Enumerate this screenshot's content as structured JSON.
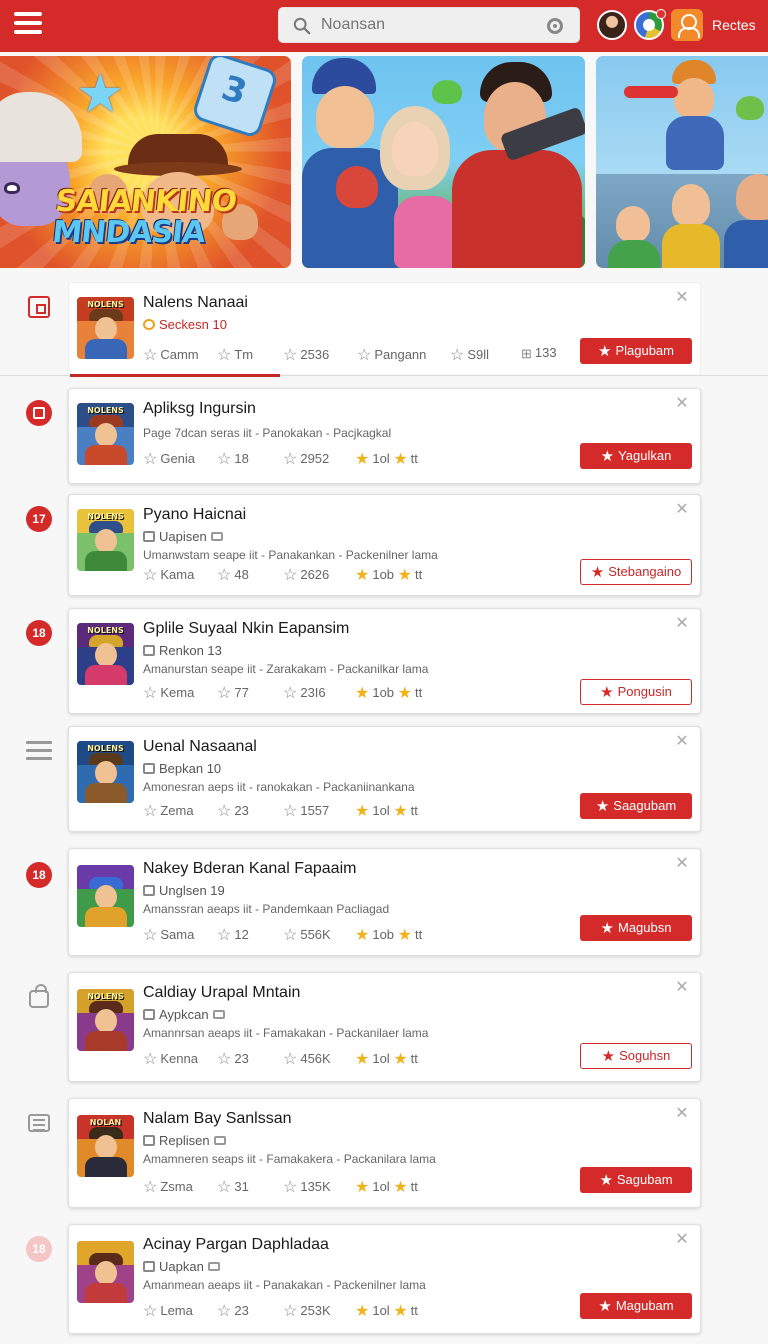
{
  "header": {
    "search_placeholder": "Noansan",
    "label": "Rectes",
    "icons": [
      "hamburger-icon",
      "search-icon",
      "mic-icon",
      "avatar",
      "chrome-icon",
      "profile-icon"
    ],
    "accent": "#d42a2a"
  },
  "banners": [
    {
      "title_line1": "SAIANKINO",
      "title_line2": "MNDASIA"
    },
    {
      "title_line1": "",
      "title_line2": ""
    },
    {
      "title_line1": "",
      "title_line2": ""
    }
  ],
  "items": [
    {
      "title": "Nalens Nanaai",
      "sub": "Seckesn 10",
      "desc": "",
      "stats": [
        "Camm",
        "Tm",
        "2536",
        "Pangann",
        "S9ll",
        "133"
      ],
      "action": "Plagubam",
      "action_style": "solid",
      "side": "square-icon"
    },
    {
      "title": "Apliksg Ingursin",
      "sub": "",
      "desc": "Page 7dcan seras iit - Panokakan - Pacjkagkal",
      "stats": [
        "Genia",
        "18",
        "2952",
        "1ol"
      ],
      "action": "Yagulkan",
      "action_style": "solid",
      "side": "ring-icon"
    },
    {
      "title": "Pyano Haicnai",
      "sub": "Uapisen",
      "desc": "Umanwstam seape iit - Panakankan - Packenilner lama",
      "stats": [
        "Kama",
        "48",
        "2626",
        "1ob"
      ],
      "action": "Stebangaino",
      "action_style": "outline",
      "side": "badge-17"
    },
    {
      "title": "Gplile Suyaal Nkin Eapansim",
      "sub": "Renkon 13",
      "desc": "Amanurstan seape iit - Zarakakam - Packanilkar lama",
      "stats": [
        "Kema",
        "77",
        "23I6",
        "1ob"
      ],
      "action": "Pongusin",
      "action_style": "outline",
      "side": "badge-18"
    },
    {
      "title": "Uenal Nasaanal",
      "sub": "Bepkan 10",
      "desc": "Amonesran aeps iit - ranokakan - Packaniinankana",
      "stats": [
        "Zema",
        "23",
        "1557",
        "1ol"
      ],
      "action": "Saagubam",
      "action_style": "solid",
      "side": "menu-icon"
    },
    {
      "title": "Nakey Bderan Kanal Fapaaim",
      "sub": "Unglsen 19",
      "desc": "Amanssran aeaps iit - Pandemkaan Pacliagad",
      "stats": [
        "Sama",
        "12",
        "556K",
        "1ob"
      ],
      "action": "Magubsn",
      "action_style": "solid",
      "side": "badge-18b"
    },
    {
      "title": "Caldiay Urapal Mntain",
      "sub": "Aypkcan",
      "desc": "Amannrsan aeaps iit - Famakakan - Packanilaer lama",
      "stats": [
        "Kenna",
        "23",
        "456K",
        "1ol"
      ],
      "action": "Soguhsn",
      "action_style": "outline",
      "side": "lock-icon"
    },
    {
      "title": "Nalam Bay Sanlssan",
      "sub": "Replisen",
      "desc": "Amamneren seaps iit - Famakakera - Packanilara lama",
      "stats": [
        "Zsma",
        "31",
        "135K",
        "1ol"
      ],
      "action": "Sagubam",
      "action_style": "solid",
      "side": "doc-icon"
    },
    {
      "title": "Acinay Pargan Daphladaa",
      "sub": "Uapkan",
      "desc": "Amanmean aeaps iit - Panakakan - Packenilner lama",
      "stats": [
        "Lema",
        "23",
        "253K",
        "1ol"
      ],
      "action": "Magubam",
      "action_style": "solid",
      "side": "badge-faded"
    }
  ],
  "badge_text": {
    "b17": "17",
    "b18": "18",
    "b18b": "18",
    "faded": "18"
  },
  "stat_half": "tt"
}
